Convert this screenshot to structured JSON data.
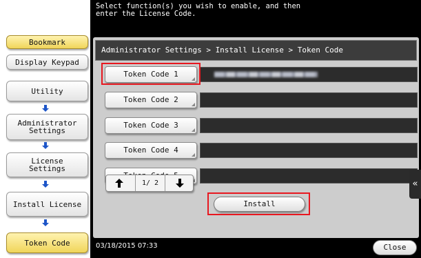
{
  "sidebar": {
    "bookmark_label": "Bookmark",
    "display_keypad_label": "Display Keypad",
    "nav": [
      {
        "label": "Utility"
      },
      {
        "label": "Administrator\nSettings"
      },
      {
        "label": "License\nSettings"
      },
      {
        "label": "Install License"
      },
      {
        "label": "Token Code"
      }
    ]
  },
  "header": {
    "instruction": "Select function(s) you wish to enable, and then\nenter the License Code."
  },
  "breadcrumb": "Administrator Settings > Install License > Token Code",
  "token_codes": [
    {
      "label": "Token Code 1",
      "value": ""
    },
    {
      "label": "Token Code 2",
      "value": ""
    },
    {
      "label": "Token Code 3",
      "value": ""
    },
    {
      "label": "Token Code 4",
      "value": ""
    },
    {
      "label": "Token Code 5",
      "value": ""
    }
  ],
  "pager": {
    "text": "1/ 2"
  },
  "install_label": "Install",
  "footer": {
    "datetime": "03/18/2015   07:33",
    "close_label": "Close"
  },
  "colors": {
    "highlight": "#e8171f",
    "sidebar_active": "#f0d55a",
    "arrow": "#1e56c8"
  },
  "icons": {
    "down_arrow": "arrow-down-icon",
    "page_up": "up-arrow-icon",
    "page_down": "down-arrow-icon",
    "side_tab": "double-arrow-left-icon"
  }
}
